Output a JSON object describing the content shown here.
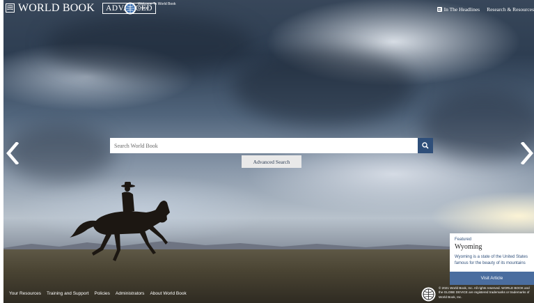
{
  "header": {
    "logo_text": "WORLD BOOK",
    "logo_badge": "ADVANCED",
    "welcome_text": "Welcome To World Book Online!",
    "nav": [
      {
        "label": "In The Headlines",
        "icon": "news-icon"
      },
      {
        "label": "Research & Resources"
      }
    ]
  },
  "search": {
    "placeholder": "Search World Book",
    "button_icon": "search-icon",
    "advanced_label": "Advanced Search"
  },
  "carousel": {
    "prev_icon": "chevron-left-icon",
    "next_icon": "chevron-right-icon"
  },
  "featured": {
    "kicker": "Featured",
    "title": "Wyoming",
    "description_line1": "Wyoming is a state of the United States",
    "description_line2": "famous for the beauty of its mountains",
    "button_label": "Visit Article"
  },
  "footer": {
    "links": [
      "Your Resources",
      "Training and Support",
      "Policies",
      "Administrators",
      "About World Book"
    ],
    "copyright_line1": "© 2021 World Book, Inc. All rights reserved. WORLD BOOK and",
    "copyright_line2": "the GLOBE DEVICE are registered trademarks or trademarks of",
    "copyright_line3": "World Book, Inc."
  },
  "colors": {
    "accent": "#2f4f7a",
    "featured_button": "#4a6d9f"
  }
}
